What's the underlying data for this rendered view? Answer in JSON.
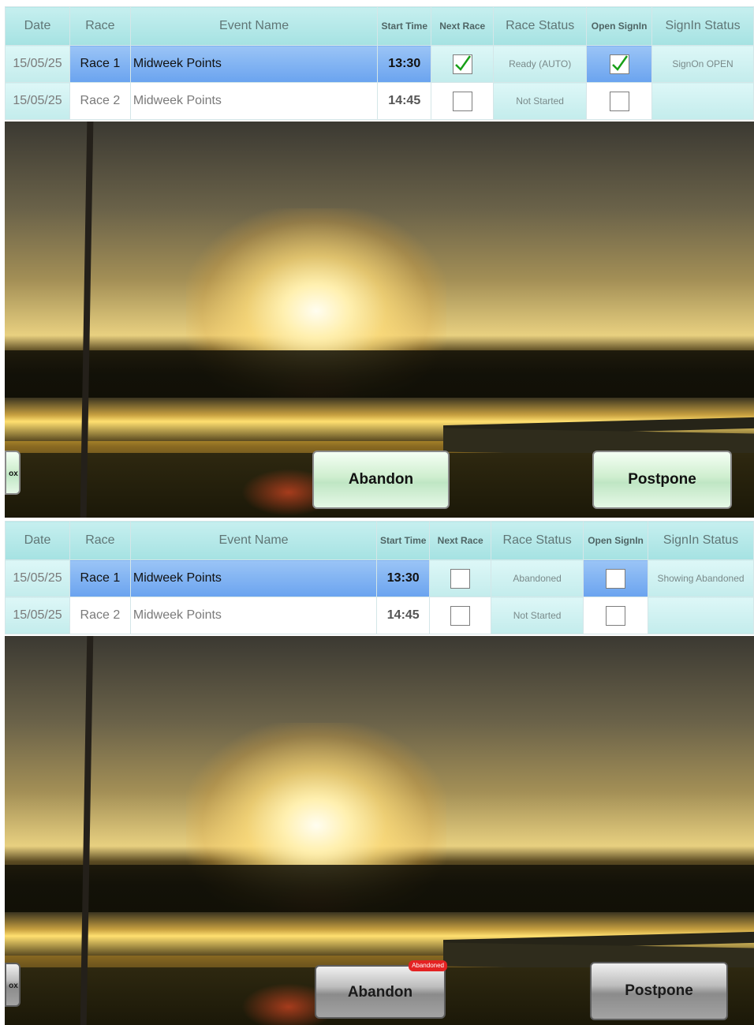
{
  "headers": {
    "date": "Date",
    "race": "Race",
    "event": "Event Name",
    "start": "Start Time",
    "next": "Next Race",
    "status": "Race Status",
    "open": "Open SignIn",
    "signin": "SignIn Status"
  },
  "top": {
    "rows": [
      {
        "date": "15/05/25",
        "race": "Race 1",
        "event": "Midweek Points",
        "start": "13:30",
        "next": true,
        "status": "Ready (AUTO)",
        "open": true,
        "signin": "SignOn OPEN"
      },
      {
        "date": "15/05/25",
        "race": "Race 2",
        "event": "Midweek Points",
        "start": "14:45",
        "next": false,
        "status": "Not Started",
        "open": false,
        "signin": ""
      }
    ],
    "box_label": "ox",
    "abandon_label": "Abandon",
    "postpone_label": "Postpone"
  },
  "bottom": {
    "rows": [
      {
        "date": "15/05/25",
        "race": "Race 1",
        "event": "Midweek Points",
        "start": "13:30",
        "next": false,
        "status": "Abandoned",
        "open": false,
        "signin": "Showing Abandoned"
      },
      {
        "date": "15/05/25",
        "race": "Race 2",
        "event": "Midweek Points",
        "start": "14:45",
        "next": false,
        "status": "Not Started",
        "open": false,
        "signin": ""
      }
    ],
    "box_label": "ox",
    "abandon_label": "Abandon",
    "abandon_badge": "Abandoned",
    "postpone_label": "Postpone"
  },
  "colors": {
    "accent_teal": "#a5e2e2",
    "selected_blue": "#6aa3ef",
    "check_green": "#18a018",
    "badge_red": "#e42222"
  }
}
